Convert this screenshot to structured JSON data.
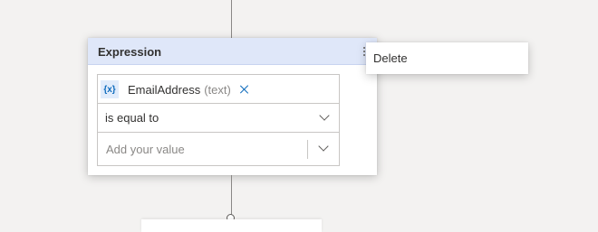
{
  "card": {
    "title": "Expression",
    "variable": {
      "icon_text": "{x}",
      "icon": "variable-icon",
      "name": "EmailAddress",
      "type": "(text)",
      "remove_icon": "close-icon"
    },
    "operator": {
      "selected": "is equal to",
      "icon": "chevron-down-icon"
    },
    "value": {
      "placeholder": "Add your value",
      "icon": "chevron-down-icon"
    }
  },
  "context_menu": {
    "items": [
      {
        "label": "Delete"
      }
    ]
  },
  "colors": {
    "canvas": "#f3f2f1",
    "header": "#dfe7f9",
    "accent": "#0f6cbd"
  }
}
